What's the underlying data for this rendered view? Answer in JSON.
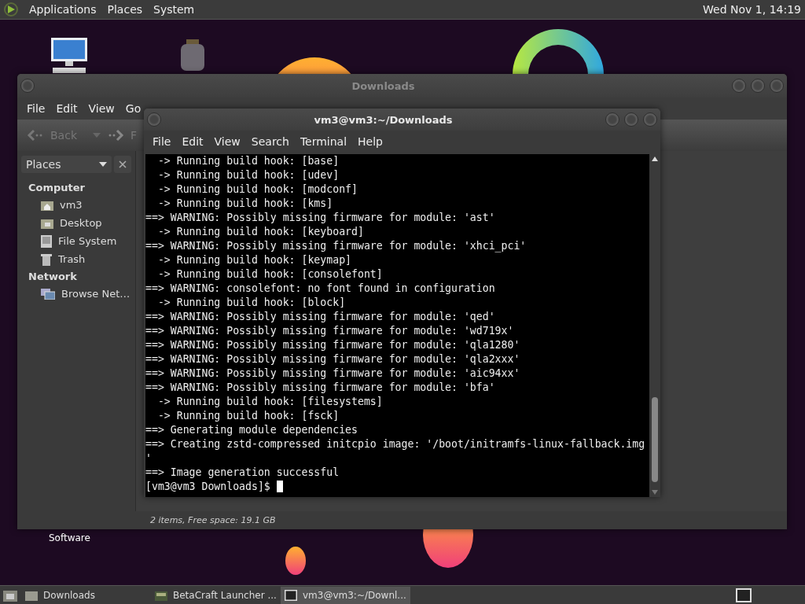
{
  "top_panel": {
    "menus": [
      "Applications",
      "Places",
      "System"
    ],
    "clock": "Wed Nov  1, 14:19"
  },
  "desktop_icons": [
    {
      "label": "Software"
    }
  ],
  "file_manager": {
    "title": "Downloads",
    "menus": [
      "File",
      "Edit",
      "View",
      "Go"
    ],
    "toolbar": {
      "back": "Back",
      "forward": "F"
    },
    "sidebar": {
      "header": "Places",
      "sections": [
        {
          "title": "Computer",
          "items": [
            {
              "label": "vm3",
              "kind": "home"
            },
            {
              "label": "Desktop",
              "kind": "desktop"
            },
            {
              "label": "File System",
              "kind": "drive"
            },
            {
              "label": "Trash",
              "kind": "trash"
            }
          ]
        },
        {
          "title": "Network",
          "items": [
            {
              "label": "Browse Net…",
              "kind": "network"
            }
          ]
        }
      ]
    },
    "status": "2 items, Free space: 19.1 GB"
  },
  "terminal": {
    "title": "vm3@vm3:~/Downloads",
    "menus": [
      "File",
      "Edit",
      "View",
      "Search",
      "Terminal",
      "Help"
    ],
    "lines": [
      "  -> Running build hook: [base]",
      "  -> Running build hook: [udev]",
      "  -> Running build hook: [modconf]",
      "  -> Running build hook: [kms]",
      "==> WARNING: Possibly missing firmware for module: 'ast'",
      "  -> Running build hook: [keyboard]",
      "==> WARNING: Possibly missing firmware for module: 'xhci_pci'",
      "  -> Running build hook: [keymap]",
      "  -> Running build hook: [consolefont]",
      "==> WARNING: consolefont: no font found in configuration",
      "  -> Running build hook: [block]",
      "==> WARNING: Possibly missing firmware for module: 'qed'",
      "==> WARNING: Possibly missing firmware for module: 'wd719x'",
      "==> WARNING: Possibly missing firmware for module: 'qla1280'",
      "==> WARNING: Possibly missing firmware for module: 'qla2xxx'",
      "==> WARNING: Possibly missing firmware for module: 'aic94xx'",
      "==> WARNING: Possibly missing firmware for module: 'bfa'",
      "  -> Running build hook: [filesystems]",
      "  -> Running build hook: [fsck]",
      "==> Generating module dependencies",
      "==> Creating zstd-compressed initcpio image: '/boot/initramfs-linux-fallback.img",
      "'",
      "==> Image generation successful"
    ],
    "prompt": "[vm3@vm3 Downloads]$ "
  },
  "taskbar": {
    "items": [
      {
        "label": "Downloads",
        "kind": "folder",
        "selected": false
      },
      {
        "label": "BetaCraft Launcher ...",
        "kind": "app",
        "selected": false
      },
      {
        "label": "vm3@vm3:~/Downl...",
        "kind": "terminal",
        "selected": true
      }
    ]
  }
}
